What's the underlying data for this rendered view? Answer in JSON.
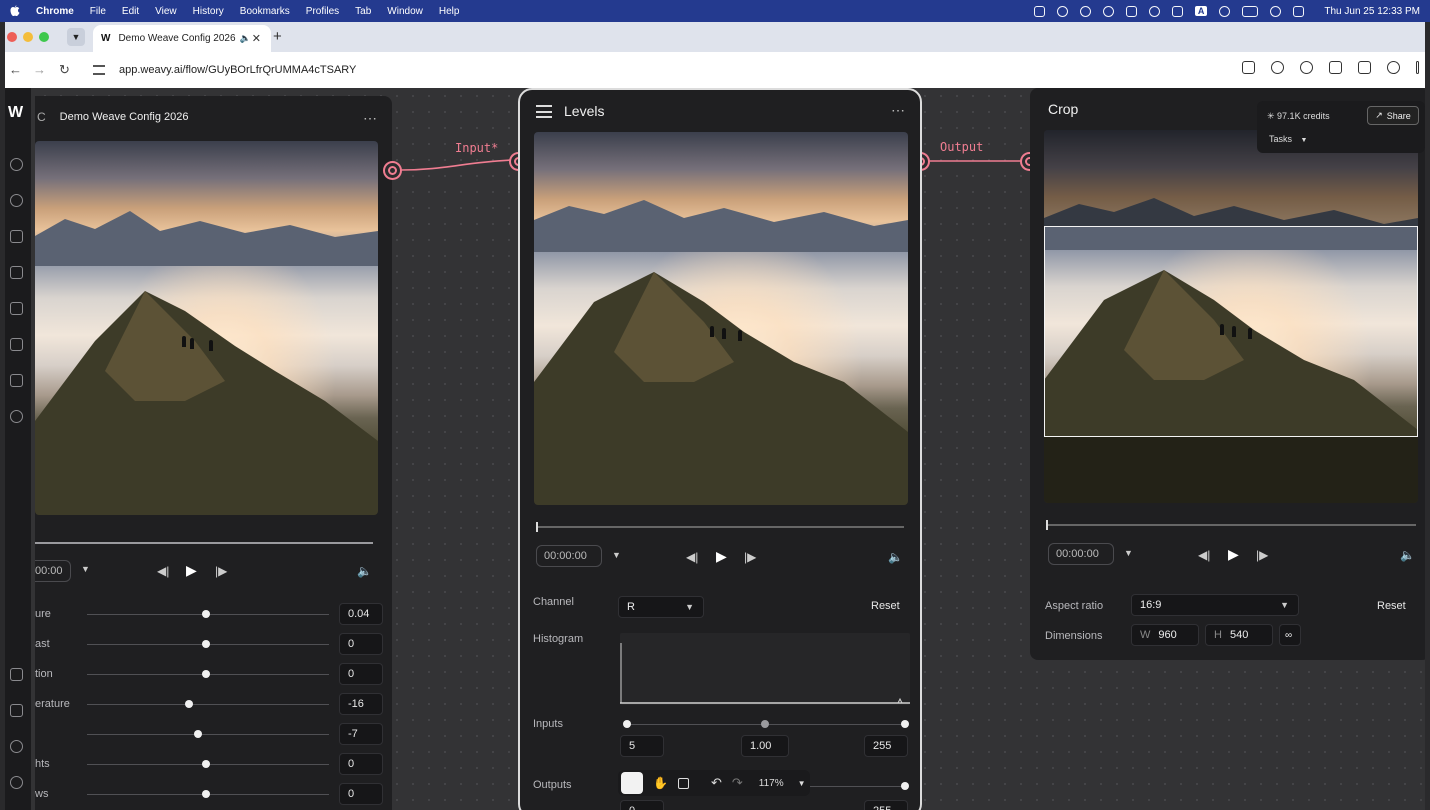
{
  "menubar": {
    "app": "Chrome",
    "items": [
      "File",
      "Edit",
      "View",
      "History",
      "Bookmarks",
      "Profiles",
      "Tab",
      "Window",
      "Help"
    ],
    "clock": "Thu Jun 25  12:33 PM",
    "status_icon_letter": "A"
  },
  "browser": {
    "tab_title": "Demo Weave Config 2026",
    "tab_favicon": "W",
    "url": "app.weavy.ai/flow/GUyBOrLfrQrUMMA4cTSARY"
  },
  "app": {
    "logo": "W",
    "project_title": "Demo Weave Config 2026",
    "credits": "97.1K credits",
    "share_label": "Share",
    "tasks_label": "Tasks"
  },
  "edges": {
    "input_label": "Input*",
    "output_label": "Output"
  },
  "left_node": {
    "partial_title_prefix": "C",
    "timecode": "00:00",
    "adjustments": [
      {
        "label": "ure",
        "value": "0.04",
        "level": 0.49
      },
      {
        "label": "ast",
        "value": "0",
        "level": 0.49
      },
      {
        "label": "tion",
        "value": "0",
        "level": 0.49
      },
      {
        "label": "erature",
        "value": "-16",
        "level": 0.42
      },
      {
        "label": "",
        "value": "-7",
        "level": 0.46
      },
      {
        "label": "hts",
        "value": "0",
        "level": 0.49
      },
      {
        "label": "ws",
        "value": "0",
        "level": 0.49
      }
    ]
  },
  "levels_node": {
    "title": "Levels",
    "timecode": "00:00:00",
    "channel_label": "Channel",
    "channel_value": "R",
    "reset_label": "Reset",
    "histogram_label": "Histogram",
    "inputs_label": "Inputs",
    "inputs": {
      "black": "5",
      "gamma": "1.00",
      "white": "255"
    },
    "outputs_label": "Outputs",
    "outputs": {
      "black": "0",
      "white": "255"
    }
  },
  "crop_node": {
    "title": "Crop",
    "timecode": "00:00:00",
    "aspect_label": "Aspect ratio",
    "aspect_value": "16:9",
    "reset_label": "Reset",
    "dimensions_label": "Dimensions",
    "w_label": "W",
    "w_value": "960",
    "h_label": "H",
    "h_value": "540"
  },
  "bottom_toolbar": {
    "zoom": "117%"
  },
  "colors": {
    "accent": "#f07d91",
    "canvas": "#333335",
    "node": "#1f1f21",
    "menubar": "#243a8f"
  }
}
